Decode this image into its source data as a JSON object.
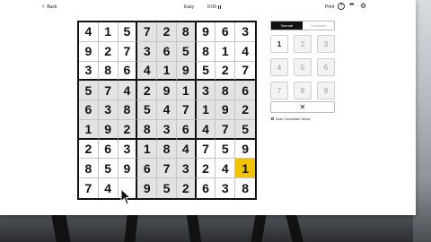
{
  "topbar": {
    "back_label": "Back",
    "difficulty": "Easy",
    "timer": "6:09",
    "print_label": "Print",
    "help_icon": "?",
    "more_icon": "•••",
    "settings_icon": "⚙"
  },
  "mode_toggle": {
    "normal_label": "Normal",
    "candidate_label": "Candidate",
    "active": "normal"
  },
  "board": {
    "rows": [
      [
        "4",
        "1",
        "5",
        "7",
        "2",
        "8",
        "9",
        "6",
        "3"
      ],
      [
        "9",
        "2",
        "7",
        "3",
        "6",
        "5",
        "8",
        "1",
        "4"
      ],
      [
        "3",
        "8",
        "6",
        "4",
        "1",
        "9",
        "5",
        "2",
        "7"
      ],
      [
        "5",
        "7",
        "4",
        "2",
        "9",
        "1",
        "3",
        "8",
        "6"
      ],
      [
        "6",
        "3",
        "8",
        "5",
        "4",
        "7",
        "1",
        "9",
        "2"
      ],
      [
        "1",
        "9",
        "2",
        "8",
        "3",
        "6",
        "4",
        "7",
        "5"
      ],
      [
        "2",
        "6",
        "3",
        "1",
        "8",
        "4",
        "7",
        "5",
        "9"
      ],
      [
        "8",
        "5",
        "9",
        "6",
        "7",
        "3",
        "2",
        "4",
        "1"
      ],
      [
        "7",
        "4",
        "",
        "9",
        "5",
        "2",
        "6",
        "3",
        "8"
      ]
    ],
    "selected_cell": [
      7,
      8
    ],
    "highlight_color": "#f2c400"
  },
  "keypad": {
    "keys": [
      "1",
      "2",
      "3",
      "4",
      "5",
      "6",
      "7",
      "8",
      "9"
    ],
    "active_key": "1",
    "erase_label": "✕"
  },
  "auto_candidate_label": "Auto Candidate Mode"
}
